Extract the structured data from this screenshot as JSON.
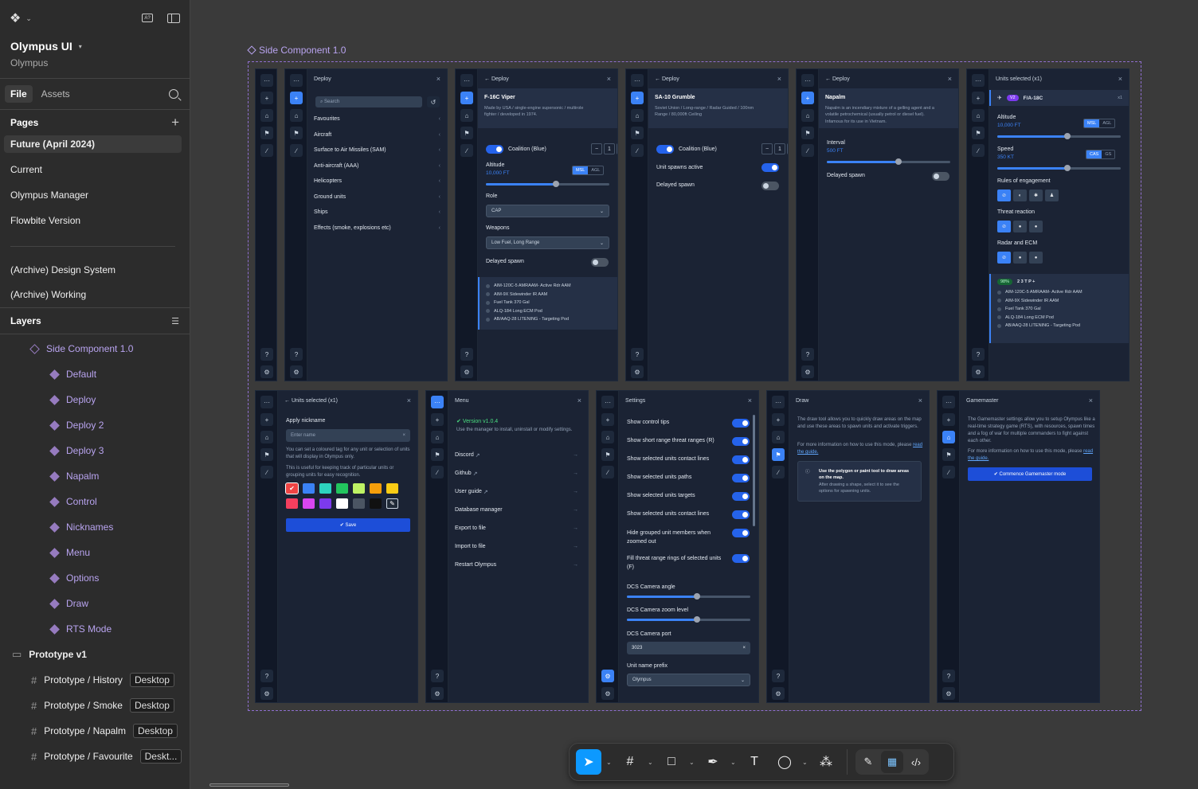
{
  "project": {
    "name": "Olympus UI",
    "team": "Olympus"
  },
  "tabs": {
    "file": "File",
    "assets": "Assets"
  },
  "pages": {
    "heading": "Pages",
    "items": [
      "Future (April 2024)",
      "Current",
      "Olympus Manager",
      "Flowbite Version",
      "(Archive) Design System",
      "(Archive) Working"
    ]
  },
  "layers": {
    "heading": "Layers",
    "component": "Side Component 1.0",
    "variants": [
      "Default",
      "Deploy",
      "Deploy 2",
      "Deploy 3",
      "Napalm",
      "Control",
      "Nicknames",
      "Menu",
      "Options",
      "Draw",
      "RTS Mode"
    ],
    "section": "Prototype v1",
    "frames": [
      {
        "name": "Prototype / History",
        "tag": "Desktop"
      },
      {
        "name": "Prototype / Smoke",
        "tag": "Desktop"
      },
      {
        "name": "Prototype / Napalm",
        "tag": "Desktop"
      },
      {
        "name": "Prototype / Favourite",
        "tag": "Deskt..."
      }
    ]
  },
  "canvas": {
    "component_label": "Side Component 1.0"
  },
  "common": {
    "close": "×",
    "more": "···",
    "help": "?",
    "gear": "⚙",
    "plus": "+"
  },
  "deploy1": {
    "title": "Deploy",
    "search_placeholder": "Search",
    "items": [
      "Favourites",
      "Aircraft",
      "Surface to Air Missiles (SAM)",
      "Anti-aircraft (AAA)",
      "Helicopters",
      "Ground units",
      "Ships",
      "Effects (smoke, explosions etc)"
    ]
  },
  "deploy2": {
    "title": "Deploy",
    "unit": "F-16C Viper",
    "desc": "Made by USA / single-engine supersonic / multirole fighter / developed in 1974.",
    "coalition": "Coalition (Blue)",
    "count": "1",
    "altitude_label": "Altitude",
    "altitude_value": "10,000 FT",
    "msl": "MSL",
    "agl": "AGL",
    "altitude_fraction": 0.57,
    "role_label": "Role",
    "role_value": "CAP",
    "weapons_label": "Weapons",
    "weapons_value": "Low Fuel, Long Range",
    "delayed": "Delayed spawn",
    "loadout": [
      "AIM-120C-5 AMRAAM- Active Rdr AAM",
      "AIM-9X Sidewinder IR AAM",
      "Fuel Tank 370 Gal",
      "ALQ-184 Long ECM Pod",
      "AB/AAQ-28 LITENING - Targeting Pod"
    ]
  },
  "deploy3": {
    "title": "Deploy",
    "unit": "SA-10 Grumble",
    "desc": "Soviet Union / Long-range / Radar Guided / 100nm Range / 80,000ft Ceiling",
    "coalition": "Coalition (Blue)",
    "count": "1",
    "active": "Unit spawns active",
    "delayed": "Delayed spawn"
  },
  "napalm": {
    "title": "Deploy",
    "unit": "Napalm",
    "desc": "Napalm is an incendiary mixture of a gelling agent and a volatile petrochemical (usually petrol or diesel fuel). Infamous for its use in Vietnam.",
    "interval_label": "Interval",
    "interval_value": "500 FT",
    "interval_fraction": 0.58,
    "delayed": "Delayed spawn"
  },
  "units": {
    "title": "Units selected (x1)",
    "badge": "V2",
    "unit": "F/A-18C",
    "count": "x1",
    "altitude_label": "Altitude",
    "altitude_value": "10,000 FT",
    "msl": "MSL",
    "agl": "AGL",
    "altitude_fraction": 0.57,
    "speed_label": "Speed",
    "speed_value": "350 KT",
    "cas": "CAS",
    "gs": "GS",
    "speed_fraction": 0.57,
    "roe": "Rules of engagement",
    "threat": "Threat reaction",
    "radar": "Radar and ECM",
    "fuel": "98%",
    "tail": "2 3 T P +",
    "loadout": [
      "AIM-120C-5 AMRAAM- Active Rdr AAM",
      "AIM-9X Sidewinder IR AAM",
      "Fuel Tank 370 Gal",
      "ALQ-184 Long ECM Pod",
      "AB/AAQ-28 LITENING - Targeting Pod"
    ]
  },
  "nick": {
    "title": "Units selected (x1)",
    "label": "Apply nickname",
    "placeholder": "Enter name",
    "desc1": "You can set a coloured tag for any unit or selection of units that will display in Olympus only.",
    "desc2": "This is useful for keeping track of particular units or grouping units for easy recognition.",
    "save": "Save",
    "colors": [
      "#ef4444",
      "#3b82f6",
      "#2dd4bf",
      "#22c55e",
      "#bef264",
      "#f59e0b",
      "#facc15",
      "#f43f5e",
      "#d946ef",
      "#7c3aed",
      "#ffffff",
      "#4b5563",
      "#111111",
      "#1f2937"
    ]
  },
  "menu": {
    "title": "Menu",
    "version": "Version v1.0.4",
    "desc": "Use the manager to install, uninstall or modify settings.",
    "items": [
      "Discord",
      "Github",
      "User guide",
      "Database manager",
      "Export to file",
      "Import to file",
      "Restart Olympus"
    ]
  },
  "settings": {
    "title": "Settings",
    "toggles": [
      "Show control tips",
      "Show short range threat ranges (R)",
      "Show selected units contact lines",
      "Show selected units paths",
      "Show selected units targets",
      "Show selected units contact lines",
      "Hide grouped unit members when zoomed out",
      "Fill threat range rings of selected units (F)"
    ],
    "cam_angle": "DCS Camera angle",
    "cam_angle_fraction": 0.57,
    "cam_zoom": "DCS Camera zoom level",
    "cam_zoom_fraction": 0.57,
    "cam_port": "DCS Camera port",
    "port_value": "3023",
    "prefix_label": "Unit name prefix",
    "prefix_value": "Olympus"
  },
  "draw": {
    "title": "Draw",
    "desc": "The draw tool allows you to quickly draw areas on the map and use these areas to spawn units and activate triggers.",
    "more": "For more information on how to use this mode, please",
    "link": "read the guide.",
    "info_title": "Use the polygon or paint tool to draw areas on the map.",
    "info_body": "After drawing a shape, select it to see the options for spawning units."
  },
  "gm": {
    "title": "Gamemaster",
    "desc": "The Gamemaster settings allow you to setup Olympus like a real-time strategy game (RTS), with resources, spawn times and a fog of war for multiple commanders to fight against each other.",
    "more": "For more information on how to use this mode, please",
    "link": "read the guide.",
    "button": "Commence Gamemaster mode"
  }
}
